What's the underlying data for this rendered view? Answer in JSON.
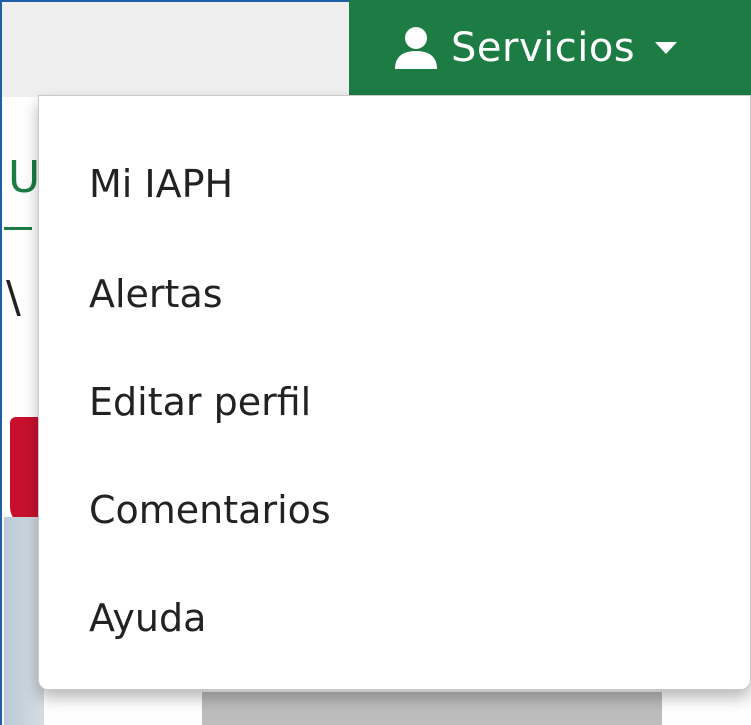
{
  "header": {
    "services_label": "Servicios"
  },
  "menu": {
    "items": [
      {
        "label": "Mi IAPH"
      },
      {
        "label": "Alertas"
      },
      {
        "label": "Editar perfil"
      },
      {
        "label": "Comentarios"
      },
      {
        "label": "Ayuda"
      }
    ]
  },
  "colors": {
    "brand_green": "#1c7c43",
    "accent_red": "#c8102e"
  }
}
